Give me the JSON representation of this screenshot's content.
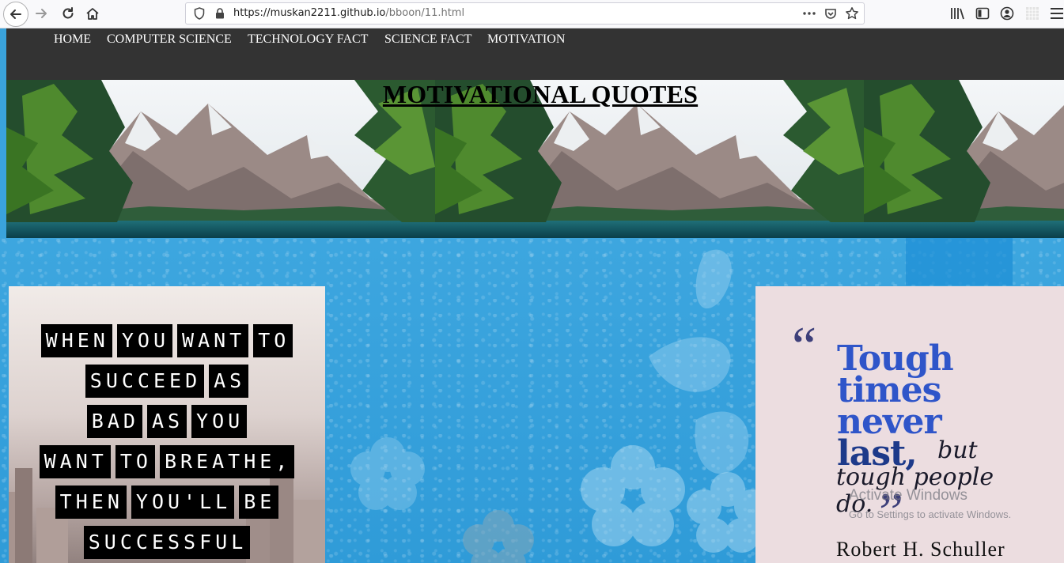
{
  "browser": {
    "url_host": "https://muskan2211.github.io",
    "url_path": "/bboon/11.html",
    "icons": [
      "back-arrow-icon",
      "forward-arrow-icon",
      "reload-icon",
      "home-icon",
      "shield-icon",
      "lock-icon",
      "more-icon",
      "pocket-icon",
      "bookmark-star-icon",
      "library-icon",
      "sidebar-icon",
      "account-icon",
      "extension-icon",
      "menu-icon"
    ]
  },
  "nav": {
    "items": [
      "HOME",
      "COMPUTER SCIENCE",
      "TECHNOLOGY FACT",
      "SCIENCE FACT",
      "MOTIVATION"
    ]
  },
  "hero": {
    "title": "MOTIVATIONAL QUOTES"
  },
  "quote_left": {
    "lines": [
      [
        "WHEN",
        "YOU",
        "WANT",
        "TO"
      ],
      [
        "SUCCEED",
        "AS"
      ],
      [
        "BAD",
        "AS",
        "YOU"
      ],
      [
        "WANT",
        "TO",
        "BREATHE,"
      ],
      [
        "THEN",
        "YOU'LL",
        "BE"
      ],
      [
        "SUCCESSFUL"
      ]
    ]
  },
  "quote_right": {
    "open_mark": "“",
    "close_mark": "”",
    "line1": "Tough",
    "line2": "times",
    "line3": "never",
    "line4": "last,",
    "line4_tail": "but",
    "line5": "tough people",
    "line6": "do.",
    "author": "Robert H. Schuller"
  },
  "watermark": {
    "title": "Activate Windows",
    "subtitle": "Go to Settings to activate Windows."
  },
  "colors": {
    "navbar": "#333333",
    "page_bg": "#3aa3dc",
    "quote_blue": "#2f55c9",
    "card_right_bg": "#ecdde0"
  }
}
